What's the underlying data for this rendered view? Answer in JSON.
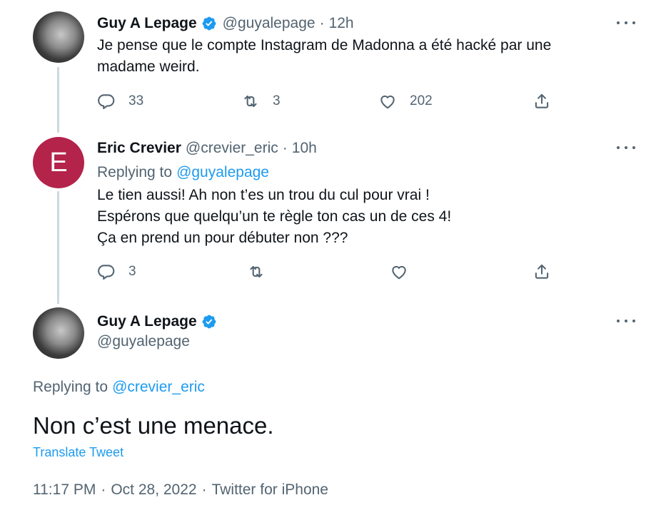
{
  "tweet1": {
    "name": "Guy A Lepage",
    "handle": "@guyalepage",
    "time": "12h",
    "text_line1": "Je pense que le compte Instagram de Madonna a été hacké par une",
    "text_line2": "madame weird.",
    "replies": "33",
    "retweets": "3",
    "likes": "202"
  },
  "tweet2": {
    "avatar_letter": "E",
    "avatar_color": "#b3234a",
    "name": "Eric Crevier",
    "handle": "@crevier_eric",
    "time": "10h",
    "replying_label": "Replying to",
    "replying_handle": "@guyalepage",
    "text_line1": "Le tien aussi! Ah non t’es un trou du cul pour vrai  !",
    "text_line2": "Espérons que quelqu’un te règle ton cas un de ces 4!",
    "text_line3": "Ça en prend un pour débuter non ???",
    "replies": "3"
  },
  "main_tweet": {
    "name": "Guy A Lepage",
    "handle": "@guyalepage",
    "replying_label": "Replying to",
    "replying_handle": "@crevier_eric",
    "text": "Non c’est une menace.",
    "translate": "Translate Tweet",
    "time": "11:17 PM",
    "date": "Oct 28, 2022",
    "source": "Twitter for iPhone",
    "sep": "·"
  },
  "colors": {
    "accent": "#1d9bf0",
    "text": "#0f1419",
    "muted": "#536471",
    "thread_line": "#cfd9de"
  },
  "icons": [
    "reply-icon",
    "retweet-icon",
    "like-icon",
    "share-icon",
    "more-icon",
    "verified-badge-icon"
  ]
}
